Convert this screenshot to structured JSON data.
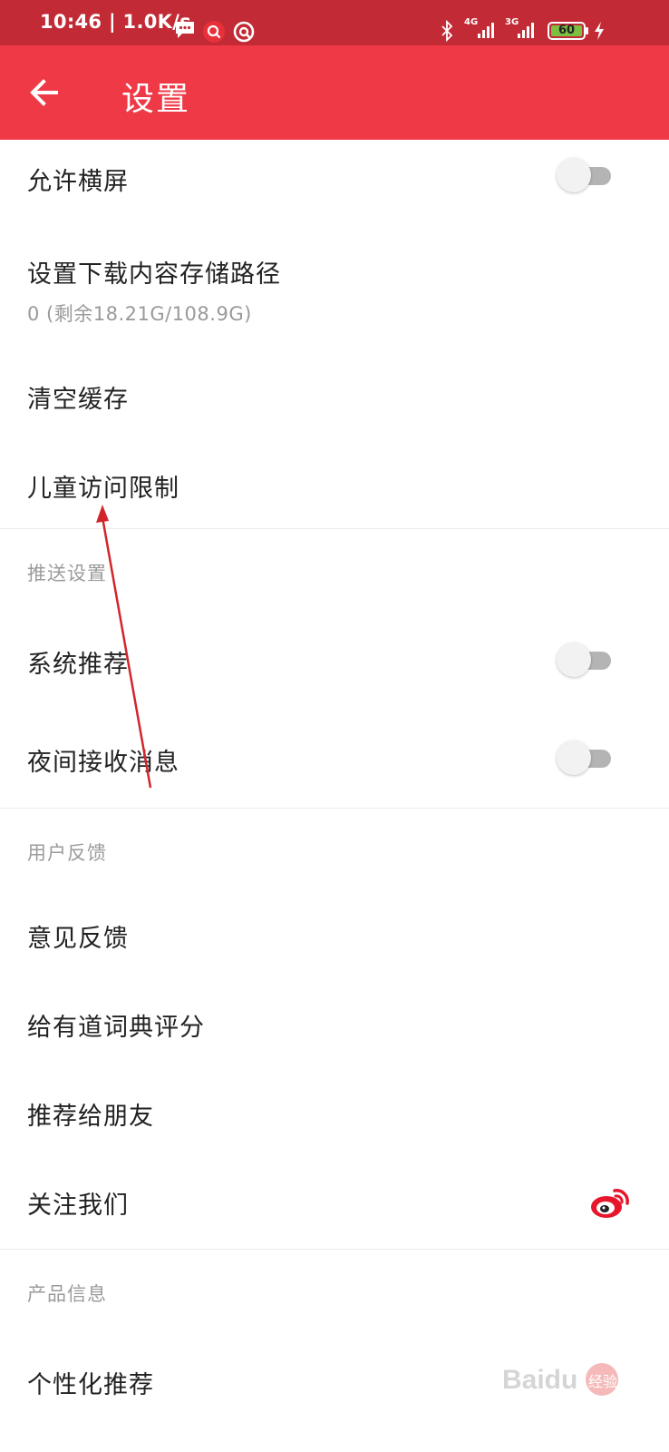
{
  "status_bar": {
    "time": "10:46 | 1.0K/s",
    "net_1": "4G",
    "net_2": "3G",
    "battery": "60"
  },
  "header": {
    "title": "设置",
    "back_icon": "back-arrow-icon"
  },
  "settings": {
    "allow_landscape": {
      "label": "允许横屏",
      "enabled": false
    },
    "download_path": {
      "label": "设置下载内容存储路径",
      "detail": "0 (剩余18.21G/108.9G)"
    },
    "clear_cache": {
      "label": "清空缓存"
    },
    "child_restriction": {
      "label": "儿童访问限制"
    }
  },
  "push_section": {
    "header": "推送设置",
    "system_recommend": {
      "label": "系统推荐",
      "enabled": false
    },
    "night_messages": {
      "label": "夜间接收消息",
      "enabled": false
    }
  },
  "feedback_section": {
    "header": "用户反馈",
    "feedback": {
      "label": "意见反馈"
    },
    "rate_app": {
      "label": "给有道词典评分"
    },
    "recommend_friends": {
      "label": "推荐给朋友"
    },
    "follow_us": {
      "label": "关注我们",
      "icon": "weibo-icon"
    }
  },
  "product_section": {
    "header": "产品信息",
    "personalized": {
      "label": "个性化推荐"
    }
  },
  "watermark": {
    "text": "Baidu经验"
  },
  "colors": {
    "status_bar": "#c22a35",
    "app_bar": "#ef3946",
    "annotation_arrow": "#d0262b",
    "weibo": "#e6162d"
  }
}
